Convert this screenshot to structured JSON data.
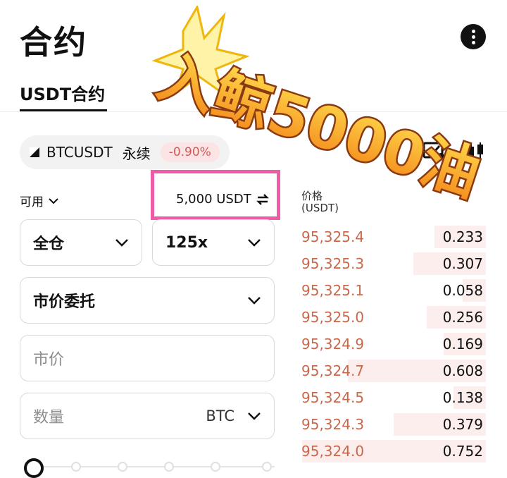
{
  "header": {
    "title": "合约",
    "menu_icon": "more-vertical-icon"
  },
  "tabs": {
    "active": "USDT合约"
  },
  "symbol": {
    "name": "BTCUSDT",
    "type": "永续",
    "change": "-0.90%"
  },
  "available": {
    "label": "可用",
    "balance": "5,000 USDT"
  },
  "form": {
    "margin_mode": "全仓",
    "leverage": "125x",
    "order_type": "市价委托",
    "price_placeholder": "市价",
    "quantity_placeholder": "数量",
    "quantity_unit": "BTC"
  },
  "slider": {
    "value": 0,
    "steps": 6
  },
  "orderbook": {
    "header_line1": "价格",
    "header_line2": "(USDT)",
    "rows": [
      {
        "price": "95,325.4",
        "qty": "0.233",
        "depth": 0.27
      },
      {
        "price": "95,325.3",
        "qty": "0.307",
        "depth": 0.38
      },
      {
        "price": "95,325.1",
        "qty": "0.058",
        "depth": 0.12
      },
      {
        "price": "95,325.0",
        "qty": "0.256",
        "depth": 0.31
      },
      {
        "price": "95,324.9",
        "qty": "0.169",
        "depth": 0.22
      },
      {
        "price": "95,324.7",
        "qty": "0.608",
        "depth": 0.72
      },
      {
        "price": "95,324.5",
        "qty": "0.138",
        "depth": 0.17
      },
      {
        "price": "95,324.3",
        "qty": "0.379",
        "depth": 0.48
      },
      {
        "price": "95,324.0",
        "qty": "0.752",
        "depth": 0.96
      }
    ]
  },
  "promo": {
    "text": "入鲸5000油"
  },
  "colors": {
    "ask": "#c8694c",
    "highlight": "#ee5ba6",
    "promo": "#f7a21b"
  }
}
